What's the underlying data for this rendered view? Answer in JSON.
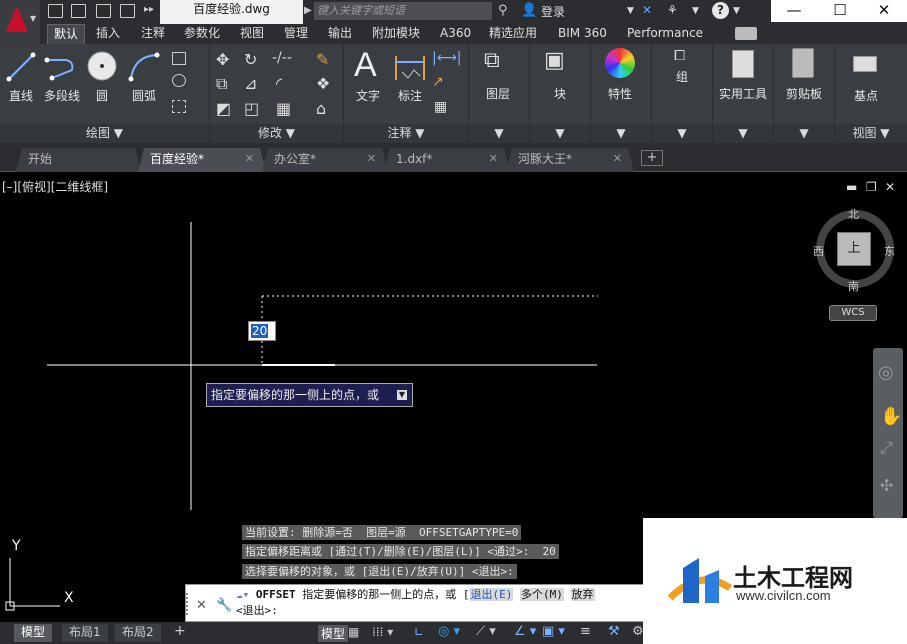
{
  "titlebar": {
    "document_title": "百度经验.dwg",
    "search_placeholder": "键入关键字或短语",
    "login_label": "登录",
    "help_icon": "?"
  },
  "ribbon_tabs": [
    "默认",
    "插入",
    "注释",
    "参数化",
    "视图",
    "管理",
    "输出",
    "附加模块",
    "A360",
    "精选应用",
    "BIM 360",
    "Performance"
  ],
  "ribbon": {
    "draw": {
      "line": "直线",
      "polyline": "多段线",
      "circle": "圆",
      "arc": "圆弧",
      "footer": "绘图 ▼"
    },
    "modify": {
      "footer": "修改 ▼"
    },
    "annotation": {
      "text": "文字",
      "dimension": "标注",
      "footer": "注释 ▼"
    },
    "layers": {
      "label": "图层"
    },
    "block": {
      "label": "块"
    },
    "properties": {
      "label": "特性"
    },
    "group": {
      "label": "组"
    },
    "utilities": {
      "label": "实用工具"
    },
    "clipboard": {
      "label": "剪贴板"
    },
    "view": {
      "label": "基点",
      "footer": "视图 ▼"
    }
  },
  "file_tabs": [
    {
      "label": "开始"
    },
    {
      "label": "百度经验*"
    },
    {
      "label": "办公室*"
    },
    {
      "label": "1.dxf*"
    },
    {
      "label": "河豚大王*"
    }
  ],
  "viewport": {
    "label": "[–][俯视][二维线框]",
    "viewcube": {
      "north": "北",
      "south": "南",
      "east": "东",
      "west": "西",
      "top": "上",
      "wcs": "WCS"
    },
    "input_value": "20",
    "tooltip": "指定要偏移的那一侧上的点，或",
    "ucs_x": "X",
    "ucs_y": "Y"
  },
  "command_history": [
    "当前设置: 删除源=否  图层=源  OFFSETGAPTYPE=0",
    "指定偏移距离或 [通过(T)/删除(E)/图层(L)] <通过>:  20",
    "选择要偏移的对象，或 [退出(E)/放弃(U)] <退出>:"
  ],
  "command_line": {
    "command": "OFFSET",
    "prompt": "指定要偏移的那一侧上的点，或 [",
    "opt_exit": "退出(E)",
    "opt_multiple": "多个(M)",
    "opt_undo": "放弃",
    "default": "<退出>:"
  },
  "status_tabs": [
    "模型",
    "布局1",
    "布局2"
  ],
  "status_model_label": "模型",
  "watermark": {
    "brand": "土木工程网",
    "url": "www.civilcn.com"
  }
}
